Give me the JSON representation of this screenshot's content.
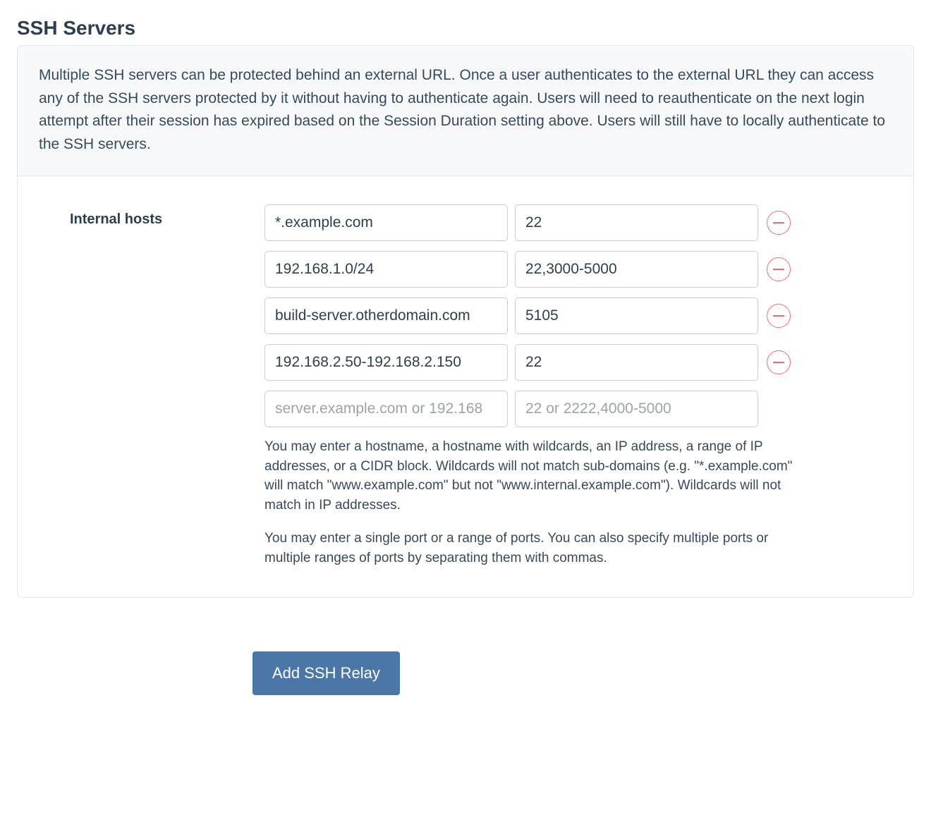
{
  "section": {
    "title": "SSH Servers",
    "description": "Multiple SSH servers can be protected behind an external URL. Once a user authenticates to the external URL they can access any of the SSH servers protected by it without having to authenticate again. Users will need to reauthenticate on the next login attempt after their session has expired based on the Session Duration setting above. Users will still have to locally authenticate to the SSH servers."
  },
  "form": {
    "label": "Internal hosts",
    "rows": [
      {
        "host": "*.example.com",
        "port": "22"
      },
      {
        "host": "192.168.1.0/24",
        "port": "22,3000-5000"
      },
      {
        "host": "build-server.otherdomain.com",
        "port": "5105"
      },
      {
        "host": "192.168.2.50-192.168.2.150",
        "port": "22"
      }
    ],
    "placeholder_row": {
      "host_placeholder": "server.example.com or 192.168",
      "port_placeholder": "22 or 2222,4000-5000"
    },
    "help1": "You may enter a hostname, a hostname with wildcards, an IP address, a range of IP addresses, or a CIDR block. Wildcards will not match sub-domains (e.g. \"*.example.com\" will match \"www.example.com\" but not \"www.internal.example.com\"). Wildcards will not match in IP addresses.",
    "help2": "You may enter a single port or a range of ports. You can also specify multiple ports or multiple ranges of ports by separating them with commas."
  },
  "actions": {
    "add_label": "Add SSH Relay"
  }
}
